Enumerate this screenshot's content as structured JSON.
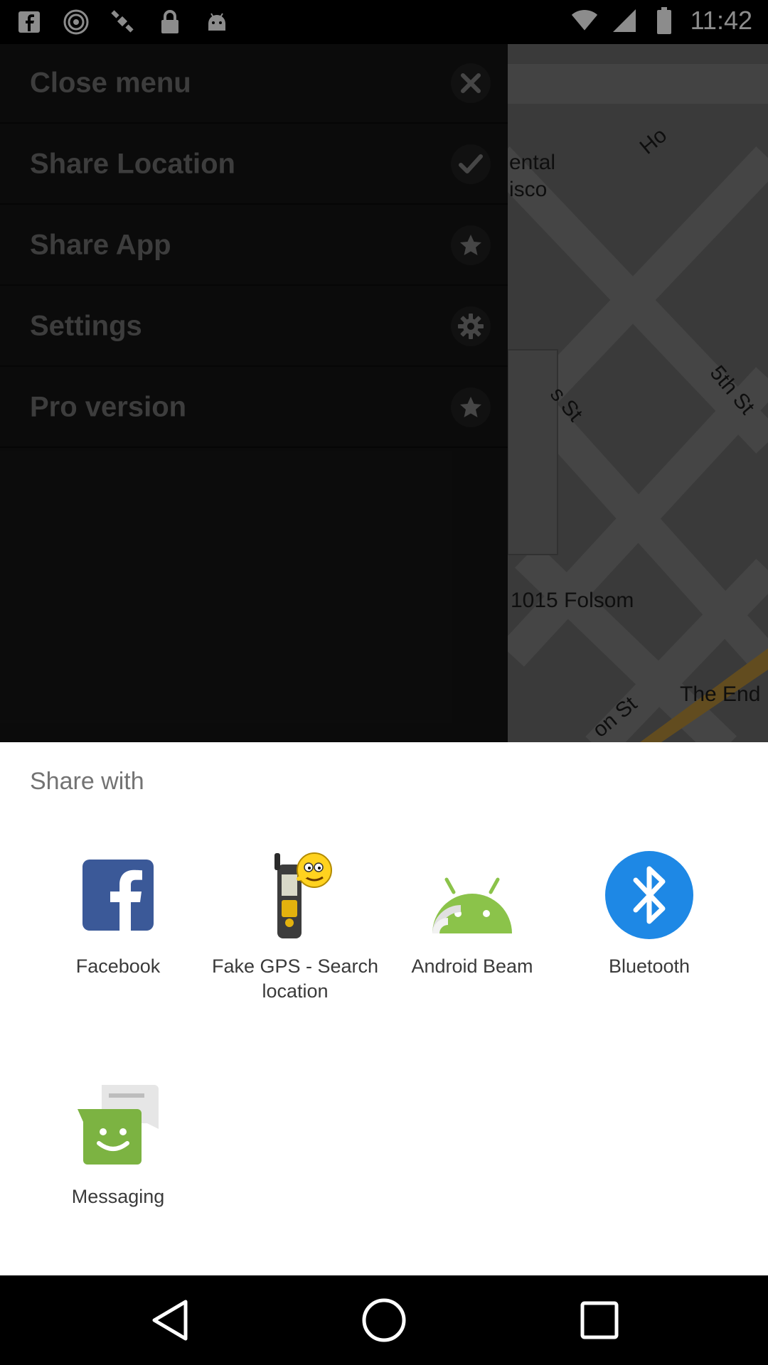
{
  "status_bar": {
    "time": "11:42",
    "left_icons": [
      "facebook-icon",
      "hotspot-icon",
      "gps-satellite-icon",
      "lock-icon",
      "android-icon"
    ],
    "right_icons": [
      "wifi-icon",
      "signal-icon",
      "battery-icon"
    ]
  },
  "drawer": {
    "items": [
      {
        "label": "Close menu",
        "icon": "close-icon"
      },
      {
        "label": "Share Location",
        "icon": "check-icon"
      },
      {
        "label": "Share App",
        "icon": "star-icon"
      },
      {
        "label": "Settings",
        "icon": "gear-icon"
      },
      {
        "label": "Pro version",
        "icon": "star-icon"
      }
    ]
  },
  "map": {
    "labels": [
      "ental",
      "isco",
      "Ho",
      "s St",
      "5th St",
      "1015 Folsom",
      "The End",
      "on St"
    ]
  },
  "share_sheet": {
    "title": "Share with",
    "apps": [
      {
        "label": "Facebook",
        "icon": "facebook-icon"
      },
      {
        "label": "Fake GPS - Search location",
        "icon": "fake-gps-icon"
      },
      {
        "label": "Android Beam",
        "icon": "android-beam-icon"
      },
      {
        "label": "Bluetooth",
        "icon": "bluetooth-icon"
      },
      {
        "label": "Messaging",
        "icon": "messaging-icon"
      }
    ]
  },
  "nav_bar": {
    "buttons": [
      "back-icon",
      "home-icon",
      "recents-icon"
    ]
  },
  "colors": {
    "facebook_blue": "#3b5998",
    "android_green": "#8bc34a",
    "bluetooth_blue": "#1e88e5",
    "messaging_green": "#7cb342"
  }
}
